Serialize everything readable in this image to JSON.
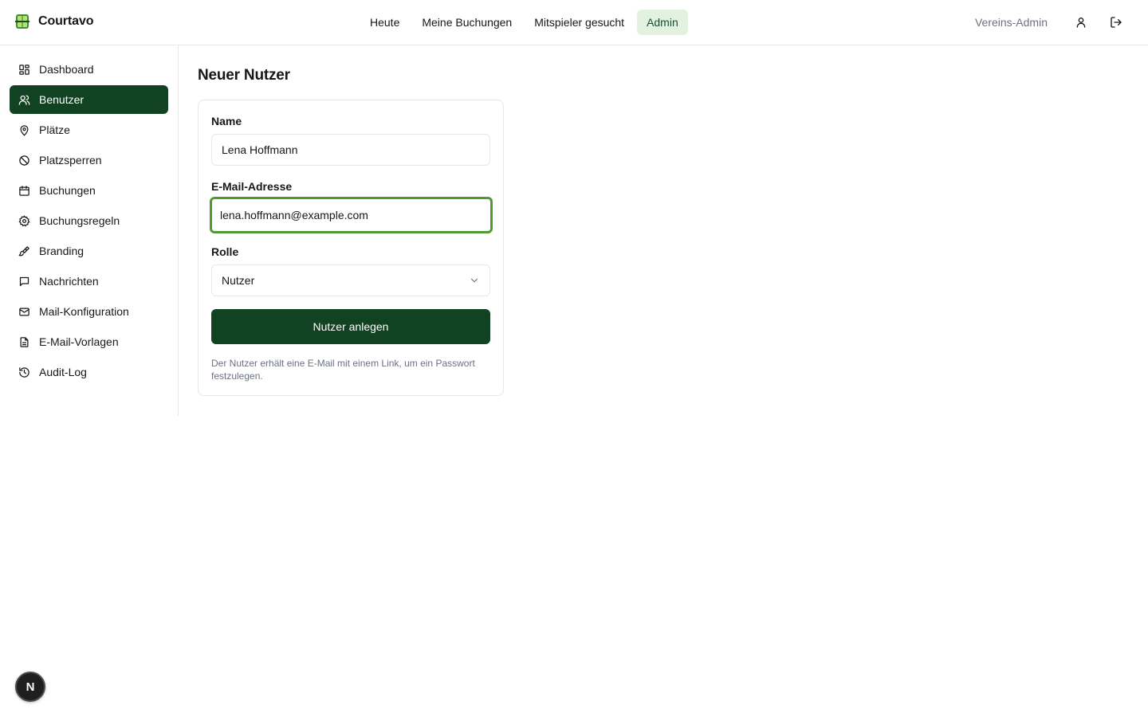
{
  "app": {
    "name": "Courtavo",
    "logo_icon": "court-logo-icon",
    "accent": "#114222",
    "accent_soft": "#e3f1df",
    "focus_ring": "#4d9a32"
  },
  "topnav": {
    "items": [
      {
        "label": "Heute",
        "active": false
      },
      {
        "label": "Meine Buchungen",
        "active": false
      },
      {
        "label": "Mitspieler gesucht",
        "active": false
      },
      {
        "label": "Admin",
        "active": true
      }
    ]
  },
  "user": {
    "role_label": "Vereins-Admin",
    "profile_icon": "user-icon",
    "logout_icon": "logout-icon"
  },
  "sidebar": {
    "items": [
      {
        "label": "Dashboard",
        "icon": "dashboard-icon",
        "active": false
      },
      {
        "label": "Benutzer",
        "icon": "users-icon",
        "active": true
      },
      {
        "label": "Plätze",
        "icon": "map-pin-icon",
        "active": false
      },
      {
        "label": "Platzsperren",
        "icon": "ban-icon",
        "active": false
      },
      {
        "label": "Buchungen",
        "icon": "calendar-icon",
        "active": false
      },
      {
        "label": "Buchungsregeln",
        "icon": "gear-icon",
        "active": false
      },
      {
        "label": "Branding",
        "icon": "paintbrush-icon",
        "active": false
      },
      {
        "label": "Nachrichten",
        "icon": "message-icon",
        "active": false
      },
      {
        "label": "Mail-Konfiguration",
        "icon": "mail-icon",
        "active": false
      },
      {
        "label": "E-Mail-Vorlagen",
        "icon": "file-text-icon",
        "active": false
      },
      {
        "label": "Audit-Log",
        "icon": "history-icon",
        "active": false
      }
    ]
  },
  "form": {
    "title": "Neuer Nutzer",
    "name_label": "Name",
    "name_value": "Lena Hoffmann",
    "email_label": "E-Mail-Adresse",
    "email_value": "lena.hoffmann@example.com",
    "role_label": "Rolle",
    "role_value": "Nutzer",
    "submit_label": "Nutzer anlegen",
    "hint": "Der Nutzer erhält eine E-Mail mit einem Link, um ein Passwort festzulegen."
  },
  "dev_badge": {
    "label": "N"
  }
}
